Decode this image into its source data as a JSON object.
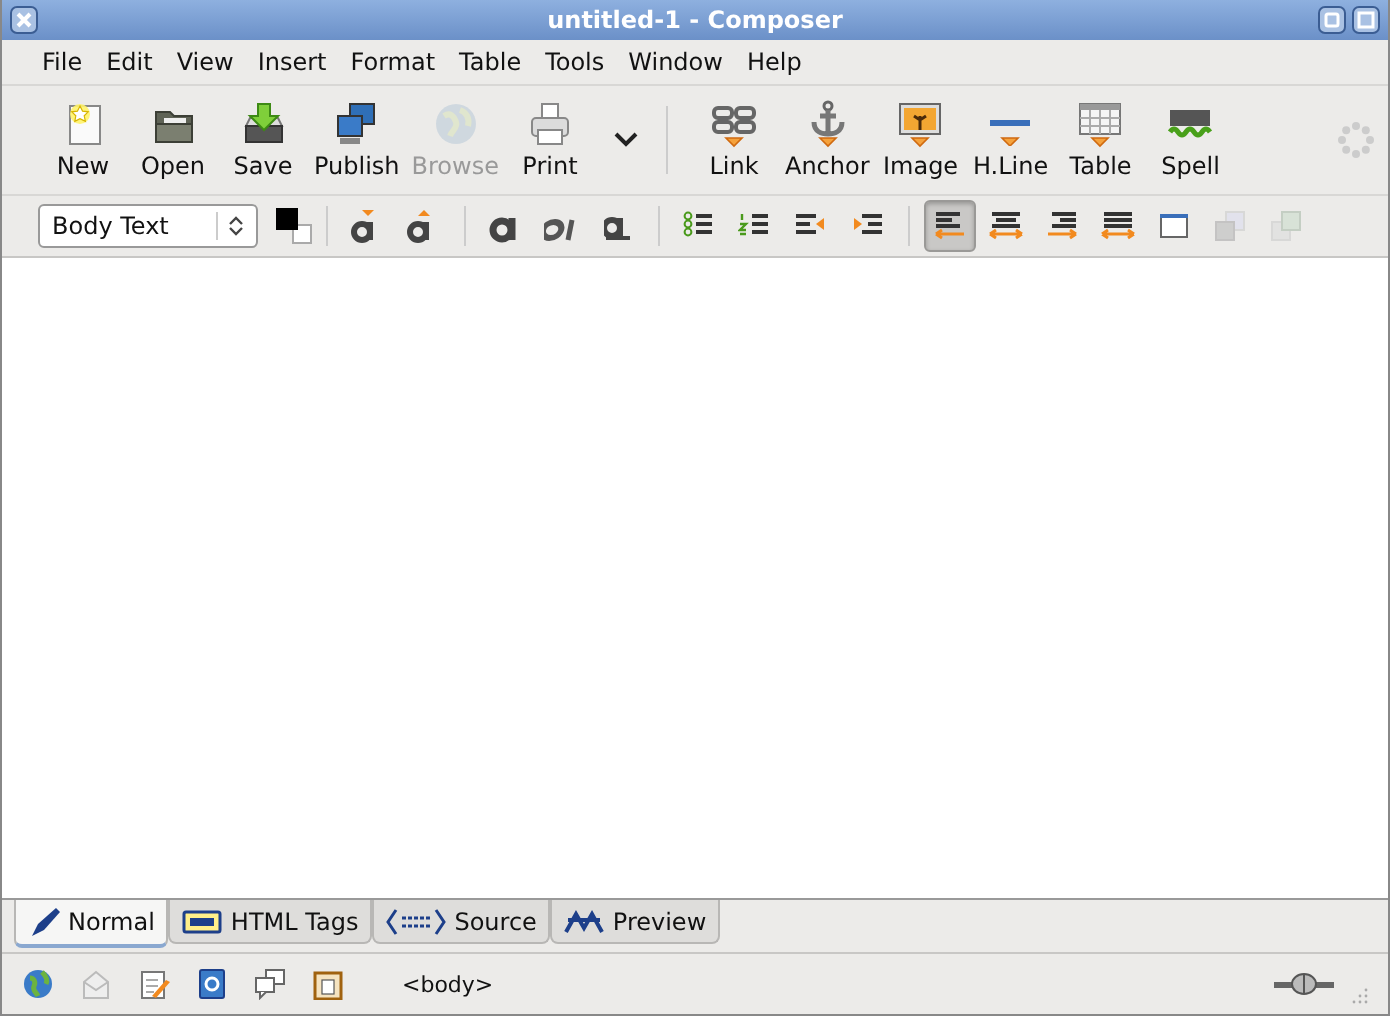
{
  "window": {
    "title": "untitled-1 - Composer"
  },
  "menu": [
    {
      "label": "File"
    },
    {
      "label": "Edit"
    },
    {
      "label": "View"
    },
    {
      "label": "Insert"
    },
    {
      "label": "Format"
    },
    {
      "label": "Table"
    },
    {
      "label": "Tools"
    },
    {
      "label": "Window"
    },
    {
      "label": "Help"
    }
  ],
  "main_toolbar": {
    "groups": [
      {
        "buttons": [
          {
            "kind": "new",
            "label": "New",
            "disabled": false
          },
          {
            "kind": "open",
            "label": "Open",
            "disabled": false
          },
          {
            "kind": "save",
            "label": "Save",
            "disabled": false
          },
          {
            "kind": "publish",
            "label": "Publish",
            "disabled": false
          },
          {
            "kind": "browse",
            "label": "Browse",
            "disabled": true
          },
          {
            "kind": "print",
            "label": "Print",
            "disabled": false
          },
          {
            "kind": "more"
          }
        ]
      },
      {
        "buttons": [
          {
            "kind": "link",
            "label": "Link",
            "disabled": false
          },
          {
            "kind": "anchor",
            "label": "Anchor",
            "disabled": false
          },
          {
            "kind": "image",
            "label": "Image",
            "disabled": false
          },
          {
            "kind": "hline",
            "label": "H.Line",
            "disabled": false
          },
          {
            "kind": "table",
            "label": "Table",
            "disabled": false
          },
          {
            "kind": "spell",
            "label": "Spell",
            "disabled": false
          }
        ]
      }
    ]
  },
  "format_toolbar": {
    "paragraph_style": "Body Text",
    "groups": [
      {
        "buttons": [
          {
            "kind": "smaller",
            "selected": false,
            "disabled": false
          },
          {
            "kind": "larger",
            "selected": false,
            "disabled": false
          }
        ]
      },
      {
        "buttons": [
          {
            "kind": "bold",
            "selected": false,
            "disabled": false
          },
          {
            "kind": "italic",
            "selected": false,
            "disabled": false
          },
          {
            "kind": "underline",
            "selected": false,
            "disabled": false
          }
        ]
      },
      {
        "buttons": [
          {
            "kind": "bullets",
            "selected": false,
            "disabled": false
          },
          {
            "kind": "numbers",
            "selected": false,
            "disabled": false
          },
          {
            "kind": "outdent",
            "selected": false,
            "disabled": false
          },
          {
            "kind": "indent",
            "selected": false,
            "disabled": false
          }
        ]
      },
      {
        "buttons": [
          {
            "kind": "align-left",
            "selected": true,
            "disabled": false
          },
          {
            "kind": "align-center",
            "selected": false,
            "disabled": false
          },
          {
            "kind": "align-right",
            "selected": false,
            "disabled": false
          },
          {
            "kind": "justify",
            "selected": false,
            "disabled": false
          },
          {
            "kind": "window",
            "selected": false,
            "disabled": false
          },
          {
            "kind": "send-back",
            "selected": false,
            "disabled": true
          },
          {
            "kind": "bring-front",
            "selected": false,
            "disabled": true
          }
        ]
      }
    ]
  },
  "tabs": [
    {
      "kind": "normal",
      "label": "Normal",
      "selected": true
    },
    {
      "kind": "tags",
      "label": "HTML Tags",
      "selected": false
    },
    {
      "kind": "source",
      "label": "Source",
      "selected": false
    },
    {
      "kind": "preview",
      "label": "Preview",
      "selected": false
    }
  ],
  "status_bar": {
    "icons": [
      {
        "kind": "globe"
      },
      {
        "kind": "mail"
      },
      {
        "kind": "notepad"
      },
      {
        "kind": "addressbook"
      },
      {
        "kind": "chat"
      },
      {
        "kind": "calendar"
      }
    ],
    "path": "<body>"
  }
}
